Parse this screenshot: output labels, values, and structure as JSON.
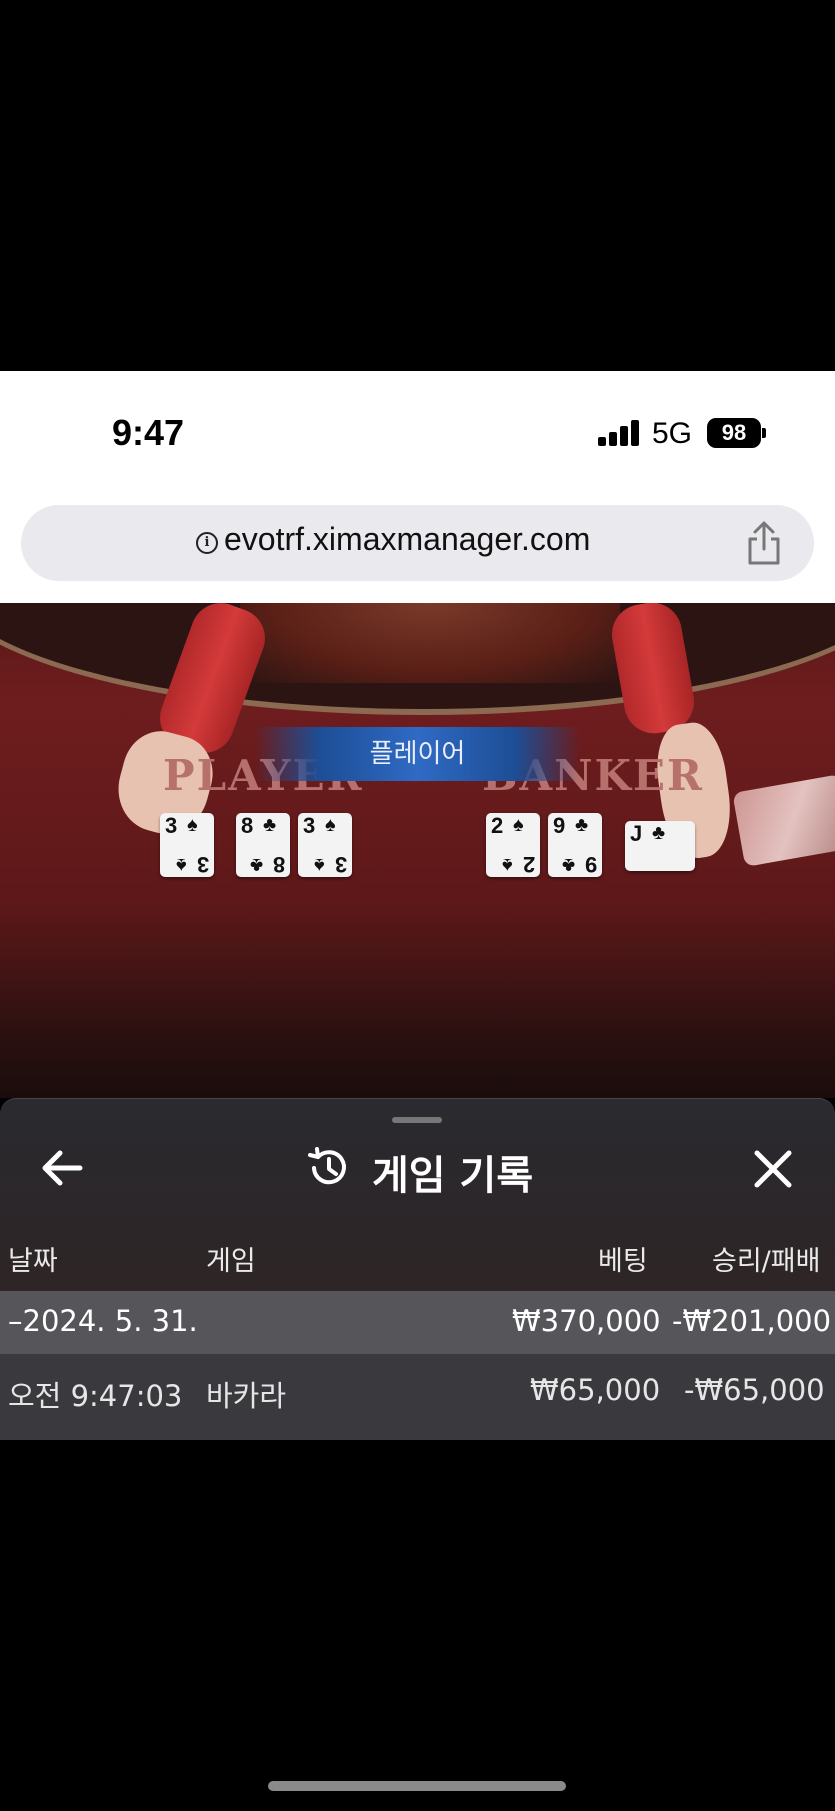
{
  "status_bar": {
    "time": "9:47",
    "network": "5G",
    "battery": "98"
  },
  "browser": {
    "url": "evotrf.ximaxmanager.com",
    "info_icon": "info-icon",
    "share_icon": "share-icon"
  },
  "video": {
    "felt_left": "PLAYER",
    "felt_right": "BANKER",
    "winner_banner": "플레이어",
    "player_cards": [
      {
        "rank": "3",
        "suit": "♠"
      },
      {
        "rank": "8",
        "suit": "♣"
      },
      {
        "rank": "3",
        "suit": "♠"
      }
    ],
    "banker_cards": [
      {
        "rank": "2",
        "suit": "♠"
      },
      {
        "rank": "9",
        "suit": "♣"
      },
      {
        "rank": "J",
        "suit": "♣"
      }
    ]
  },
  "panel": {
    "title": "게임 기록",
    "back_icon": "arrow-left-icon",
    "history_icon": "history-icon",
    "close_icon": "close-icon",
    "columns": {
      "date": "날짜",
      "game": "게임",
      "bet": "베팅",
      "win_loss": "승리/패배"
    },
    "summary_row": {
      "date": "–2024. 5. 31.",
      "bet": "₩370,000",
      "win_loss": "-₩201,000"
    },
    "rows": [
      {
        "time": "오전 9:47:03",
        "game": "바카라",
        "bet": "₩65,000",
        "win_loss": "-₩65,000"
      }
    ]
  },
  "colors": {
    "felt": "#6e1d1e",
    "banner": "#2f6ac4",
    "panel_bg": "#2a2a30",
    "summary_row_bg": "#55555a"
  }
}
